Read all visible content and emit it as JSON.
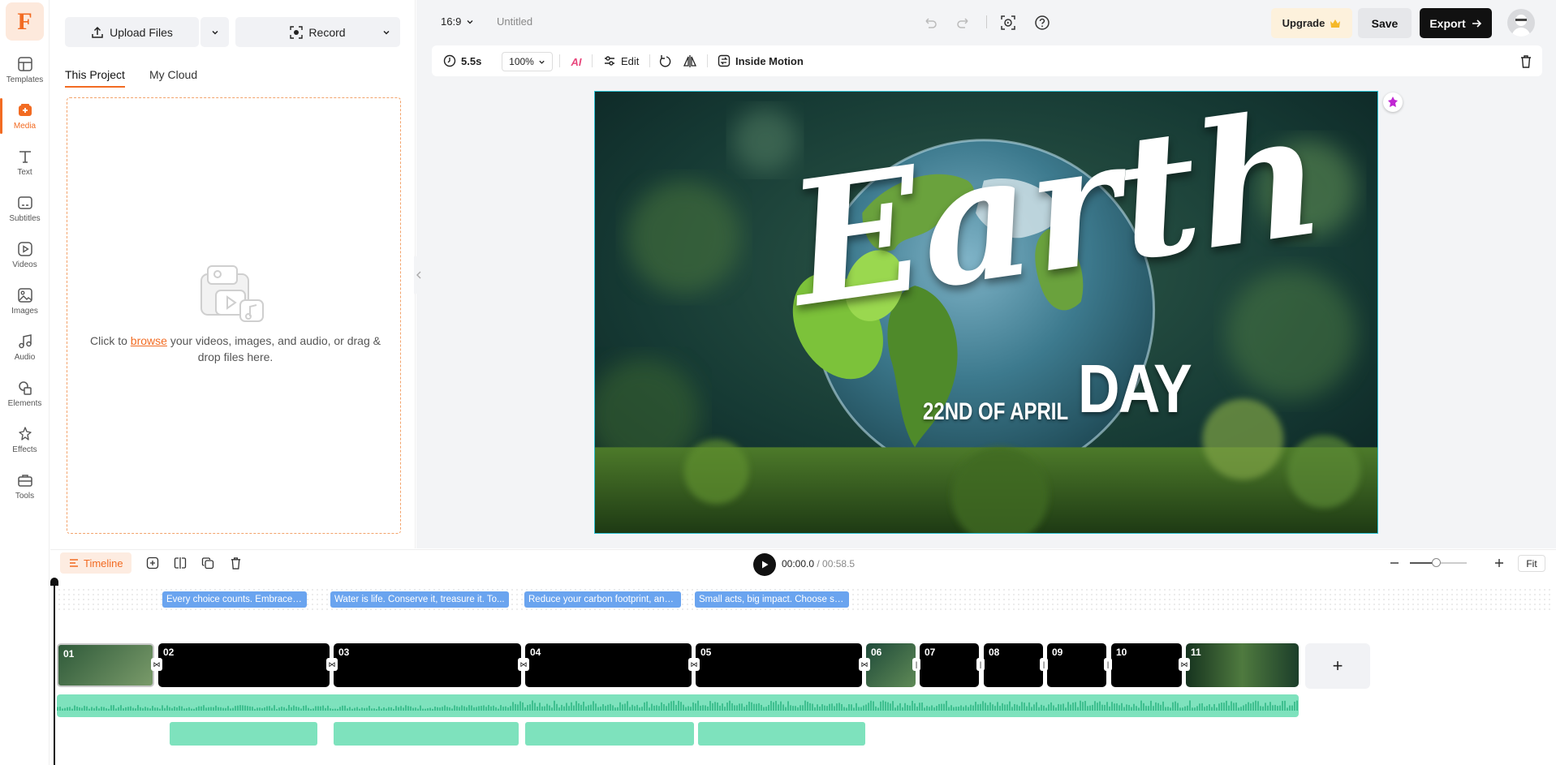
{
  "app": {
    "logo_letter": "F",
    "accent_color": "#f26b22"
  },
  "rail": {
    "items": [
      {
        "label": "Templates",
        "icon": "templates-icon"
      },
      {
        "label": "Media",
        "icon": "media-icon",
        "active": true
      },
      {
        "label": "Text",
        "icon": "text-icon"
      },
      {
        "label": "Subtitles",
        "icon": "subtitles-icon"
      },
      {
        "label": "Videos",
        "icon": "videos-icon"
      },
      {
        "label": "Images",
        "icon": "images-icon"
      },
      {
        "label": "Audio",
        "icon": "audio-icon"
      },
      {
        "label": "Elements",
        "icon": "elements-icon"
      },
      {
        "label": "Effects",
        "icon": "effects-icon"
      },
      {
        "label": "Tools",
        "icon": "tools-icon"
      }
    ]
  },
  "media_panel": {
    "upload_label": "Upload Files",
    "record_label": "Record",
    "tabs": [
      "This Project",
      "My Cloud"
    ],
    "drop_before": "Click to ",
    "drop_link": "browse",
    "drop_after": " your videos, images, and audio, or drag & drop files here."
  },
  "header": {
    "aspect": "16:9",
    "project_name": "Untitled",
    "upgrade_label": "Upgrade",
    "save_label": "Save",
    "export_label": "Export"
  },
  "toolbar": {
    "duration": "5.5s",
    "zoom": "100%",
    "edit_label": "Edit",
    "motion_label": "Inside Motion"
  },
  "canvas": {
    "title_word": "Earth",
    "title_word2": "DAY",
    "date_text": "22ND OF APRIL"
  },
  "timeline": {
    "tab_label": "Timeline",
    "current_time": "00:00.0",
    "total_time": "/ 00:58.5",
    "fit_label": "Fit",
    "add_label": "+",
    "subtitles": [
      "Every choice counts. Embrace ...",
      "Water is life. Conserve it, treasure it. To...",
      "Reduce your carbon footprint, and...",
      "Small acts, big impact. Choose su..."
    ],
    "clips": [
      "01",
      "02",
      "03",
      "04",
      "05",
      "06",
      "07",
      "08",
      "09",
      "10",
      "11"
    ]
  }
}
